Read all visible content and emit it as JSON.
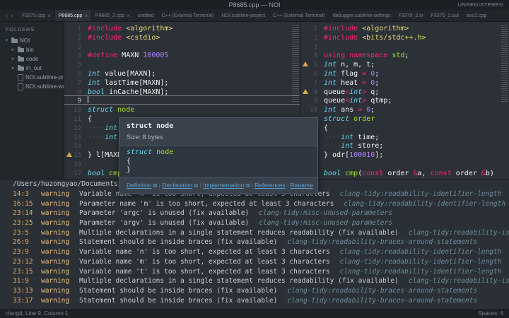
{
  "window": {
    "title": "P8685.cpp — NOI",
    "registration": "UNREGISTERED"
  },
  "icons": {
    "nav_back": "‹",
    "nav_forward": "›",
    "close": "×",
    "external_link": "⧉",
    "folder_expanded": "▾",
    "folder_collapsed": "▸",
    "warning": "warning-triangle"
  },
  "colors": {
    "editor_bg": "#2c3137",
    "chrome_bg": "#21262b",
    "warning": "#d9a74f",
    "link": "#5da2d5",
    "keyword": "#f92672",
    "type": "#66d9ef",
    "number": "#ae81ff",
    "string": "#e6db74",
    "function": "#a6e22e"
  },
  "tabbar": {
    "tabs": [
      {
        "label": "F3375.cpp",
        "active": false,
        "closable": true
      },
      {
        "label": "P8685.cpp",
        "active": true,
        "closable": true
      },
      {
        "label": "P8685_2.cpp",
        "active": false,
        "closable": true
      },
      {
        "label": "untitled",
        "active": false,
        "closable": false
      },
      {
        "label": "C++ (External Terminal)",
        "active": false,
        "closable": false
      },
      {
        "label": "NOI.sublime-project",
        "active": false,
        "closable": false
      },
      {
        "label": "C++ (External Terminal)",
        "active": false,
        "closable": false
      },
      {
        "label": "debugger.sublime-settings",
        "active": false,
        "closable": false
      },
      {
        "label": "F3375_2.in",
        "active": false,
        "closable": false
      },
      {
        "label": "F3375_2.out",
        "active": false,
        "closable": false
      },
      {
        "label": "test2.cpp",
        "active": false,
        "closable": false
      }
    ]
  },
  "sidebar": {
    "header": "FOLDERS",
    "items": [
      {
        "label": "NOI",
        "depth": 0,
        "kind": "folder",
        "expanded": true
      },
      {
        "label": "bin",
        "depth": 1,
        "kind": "folder",
        "expanded": false
      },
      {
        "label": "code",
        "depth": 1,
        "kind": "folder",
        "expanded": false
      },
      {
        "label": "in_out",
        "depth": 1,
        "kind": "folder",
        "expanded": false
      },
      {
        "label": "NOI.sublime-project",
        "depth": 1,
        "kind": "file",
        "expanded": false
      },
      {
        "label": "NOI.sublime-workspace",
        "depth": 1,
        "kind": "file",
        "expanded": false
      }
    ]
  },
  "editors": {
    "left": {
      "cursor_line": 9,
      "warning_lines": [
        15
      ],
      "lines": [
        [
          [
            "#include",
            "pp"
          ],
          [
            " ",
            "pl"
          ],
          [
            "<algorithm>",
            "str"
          ]
        ],
        [
          [
            "#include",
            "pp"
          ],
          [
            " ",
            "pl"
          ],
          [
            "<cstdio>",
            "str"
          ]
        ],
        [],
        [
          [
            "#define",
            "pp"
          ],
          [
            " MAXN ",
            "pl"
          ],
          [
            "100005",
            "num"
          ]
        ],
        [],
        [
          [
            "int",
            "type"
          ],
          [
            " value[MAXN];",
            "pl"
          ]
        ],
        [
          [
            "int",
            "type"
          ],
          [
            " lastTime[MAXN];",
            "pl"
          ]
        ],
        [
          [
            "bool",
            "type"
          ],
          [
            " inCache[MAXN];",
            "pl"
          ]
        ],
        [],
        [
          [
            "struct",
            "type"
          ],
          [
            " ",
            "pl"
          ],
          [
            "node",
            "fn"
          ]
        ],
        [
          [
            "{",
            "pl"
          ]
        ],
        [
          [
            "····",
            "ws"
          ],
          [
            "int",
            "type"
          ],
          [
            "·",
            "ws"
          ],
          [
            "t",
            "pl"
          ]
        ],
        [
          [
            "····",
            "ws"
          ],
          [
            "int",
            "type"
          ]
        ],
        [],
        [
          [
            "} l[MAXN",
            "pl"
          ]
        ],
        [],
        [
          [
            "bool",
            "type"
          ],
          [
            " ",
            "pl"
          ],
          [
            "cmp",
            "fn"
          ],
          [
            "(",
            "pl"
          ]
        ]
      ]
    },
    "right": {
      "cursor_line": 0,
      "warning_lines": [
        5,
        8
      ],
      "lines": [
        [
          [
            "#include",
            "pp"
          ],
          [
            " ",
            "pl"
          ],
          [
            "<algorithm>",
            "str"
          ]
        ],
        [
          [
            "#include",
            "pp"
          ],
          [
            " ",
            "pl"
          ],
          [
            "<bits/stdc++.h>",
            "str"
          ]
        ],
        [],
        [
          [
            "using",
            "kw"
          ],
          [
            " ",
            "pl"
          ],
          [
            "namespace",
            "kw"
          ],
          [
            " ",
            "pl"
          ],
          [
            "std",
            "fn"
          ],
          [
            ";",
            "pl"
          ]
        ],
        [
          [
            "int",
            "type"
          ],
          [
            " n, m, t;",
            "pl"
          ]
        ],
        [
          [
            "int",
            "type"
          ],
          [
            " flag ",
            "pl"
          ],
          [
            "=",
            "op"
          ],
          [
            " ",
            "pl"
          ],
          [
            "0",
            "num"
          ],
          [
            ";",
            "pl"
          ]
        ],
        [
          [
            "int",
            "type"
          ],
          [
            " heat ",
            "pl"
          ],
          [
            "=",
            "op"
          ],
          [
            " ",
            "pl"
          ],
          [
            "0",
            "num"
          ],
          [
            ";",
            "pl"
          ]
        ],
        [
          [
            "queue",
            "pl"
          ],
          [
            "<",
            "op"
          ],
          [
            "int",
            "type"
          ],
          [
            ">",
            "op"
          ],
          [
            " q;",
            "pl"
          ]
        ],
        [
          [
            "queue",
            "pl"
          ],
          [
            "<",
            "op"
          ],
          [
            "int",
            "type"
          ],
          [
            ">",
            "op"
          ],
          [
            " qtmp;",
            "pl"
          ]
        ],
        [
          [
            "int",
            "type"
          ],
          [
            " ans ",
            "pl"
          ],
          [
            "=",
            "op"
          ],
          [
            " ",
            "pl"
          ],
          [
            "0",
            "num"
          ],
          [
            ";",
            "pl"
          ]
        ],
        [
          [
            "struct",
            "type"
          ],
          [
            " ",
            "pl"
          ],
          [
            "order",
            "fn"
          ]
        ],
        [
          [
            "{",
            "pl"
          ]
        ],
        [
          [
            "····",
            "ws"
          ],
          [
            "int",
            "type"
          ],
          [
            " time;",
            "pl"
          ]
        ],
        [
          [
            "····",
            "ws"
          ],
          [
            "int",
            "type"
          ],
          [
            " store;",
            "pl"
          ]
        ],
        [
          [
            "} odr[",
            "pl"
          ],
          [
            "100010",
            "num"
          ],
          [
            "];",
            "pl"
          ]
        ],
        [],
        [
          [
            "bool",
            "type"
          ],
          [
            " ",
            "pl"
          ],
          [
            "cmp",
            "fn"
          ],
          [
            "(",
            "pl"
          ],
          [
            "const",
            "kw"
          ],
          [
            " order ",
            "pl"
          ],
          [
            "&",
            "op"
          ],
          [
            "a, ",
            "pl"
          ],
          [
            "const",
            "kw"
          ],
          [
            " order ",
            "pl"
          ],
          [
            "&",
            "op"
          ],
          [
            "b)",
            "pl"
          ]
        ]
      ]
    }
  },
  "tooltip": {
    "title": "struct node",
    "subtitle": "Size: 8 bytes",
    "code_lines": [
      [
        [
          "struct",
          "type"
        ],
        [
          " ",
          "pl"
        ],
        [
          "node",
          "fn"
        ]
      ],
      [
        [
          "{",
          "pl"
        ]
      ],
      [
        [
          "}",
          "pl"
        ]
      ]
    ],
    "links": [
      {
        "label": "Definition",
        "external": true
      },
      {
        "label": "Declaration",
        "external": true
      },
      {
        "label": "Implementation",
        "external": true
      },
      {
        "label": "References",
        "external": false
      },
      {
        "label": "Rename",
        "external": false
      }
    ]
  },
  "bottom_panel": {
    "path": "/Users/huzongyao/Documents/pr",
    "diagnostics": [
      {
        "loc": "14:3",
        "severity": "warning",
        "message": "Variable name 'n' is too short, expected at least 3 characters",
        "rule": "clang-tidy:readability-identifier-length"
      },
      {
        "loc": "16:15",
        "severity": "warning",
        "message": "Parameter name 'm' is too short, expected at least 3 characters",
        "rule": "clang-tidy:readability-identifier-length"
      },
      {
        "loc": "23:14",
        "severity": "warning",
        "message": "Parameter 'argc' is unused (fix available)",
        "rule": "clang-tidy:misc-unused-parameters"
      },
      {
        "loc": "23:25",
        "severity": "warning",
        "message": "Parameter 'argv' is unused (fix available)",
        "rule": "clang-tidy:misc-unused-parameters"
      },
      {
        "loc": "23:5",
        "severity": "warning",
        "message": "Multiple declarations in a single statement reduces readability (fix available)",
        "rule": "clang-tidy:readability-isolate-declaration"
      },
      {
        "loc": "26:9",
        "severity": "warning",
        "message": "Statement should be inside braces (fix available)",
        "rule": "clang-tidy:readability-braces-around-statements"
      },
      {
        "loc": "23:9",
        "severity": "warning",
        "message": "Variable name 'n' is too short, expected at least 3 characters",
        "rule": "clang-tidy:readability-identifier-length"
      },
      {
        "loc": "23:12",
        "severity": "warning",
        "message": "Variable name 'm' is too short, expected at least 3 characters",
        "rule": "clang-tidy:readability-identifier-length"
      },
      {
        "loc": "23:15",
        "severity": "warning",
        "message": "Variable name 't' is too short, expected at least 3 characters",
        "rule": "clang-tidy:readability-identifier-length"
      },
      {
        "loc": "31:9",
        "severity": "warning",
        "message": "Multiple declarations in a single statement reduces readability (fix available)",
        "rule": "clang-tidy:readability-isolate-declaration"
      },
      {
        "loc": "33:13",
        "severity": "warning",
        "message": "Statement should be inside braces (fix available)",
        "rule": "clang-tidy:readability-braces-around-statements"
      },
      {
        "loc": "33:17",
        "severity": "warning",
        "message": "Statement should be inside braces (fix available)",
        "rule": "clang-tidy:readability-braces-around-statements"
      }
    ]
  },
  "statusbar": {
    "left": "clangd, Line 9, Column 1",
    "right": "Spaces: 4"
  }
}
